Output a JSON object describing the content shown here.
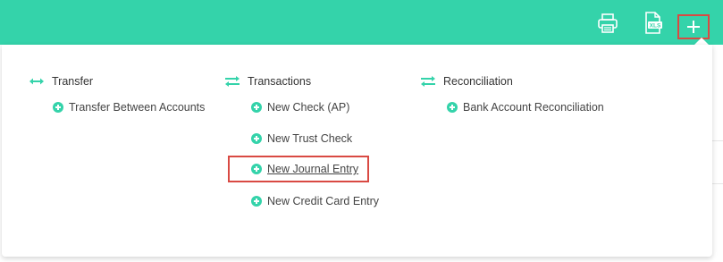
{
  "toolbar": {
    "print_icon": "printer-icon",
    "xls_icon": "xls-export-icon",
    "xls_text": "XLS",
    "add_icon": "plus-icon",
    "accent_color": "#34d3aa",
    "highlight_color": "#d94a43"
  },
  "menu": {
    "columns": [
      {
        "heading": "Transfer",
        "icon": "two-way-arrow-icon",
        "items": [
          {
            "label": "Transfer Between Accounts"
          }
        ]
      },
      {
        "heading": "Transactions",
        "icon": "swap-arrows-icon",
        "items": [
          {
            "label": "New Check (AP)"
          },
          {
            "label": "New Trust Check"
          },
          {
            "label": "New Journal Entry"
          },
          {
            "label": "New Credit Card Entry"
          }
        ]
      },
      {
        "heading": "Reconciliation",
        "icon": "swap-arrows-icon",
        "items": [
          {
            "label": "Bank Account Reconciliation"
          }
        ]
      }
    ]
  }
}
